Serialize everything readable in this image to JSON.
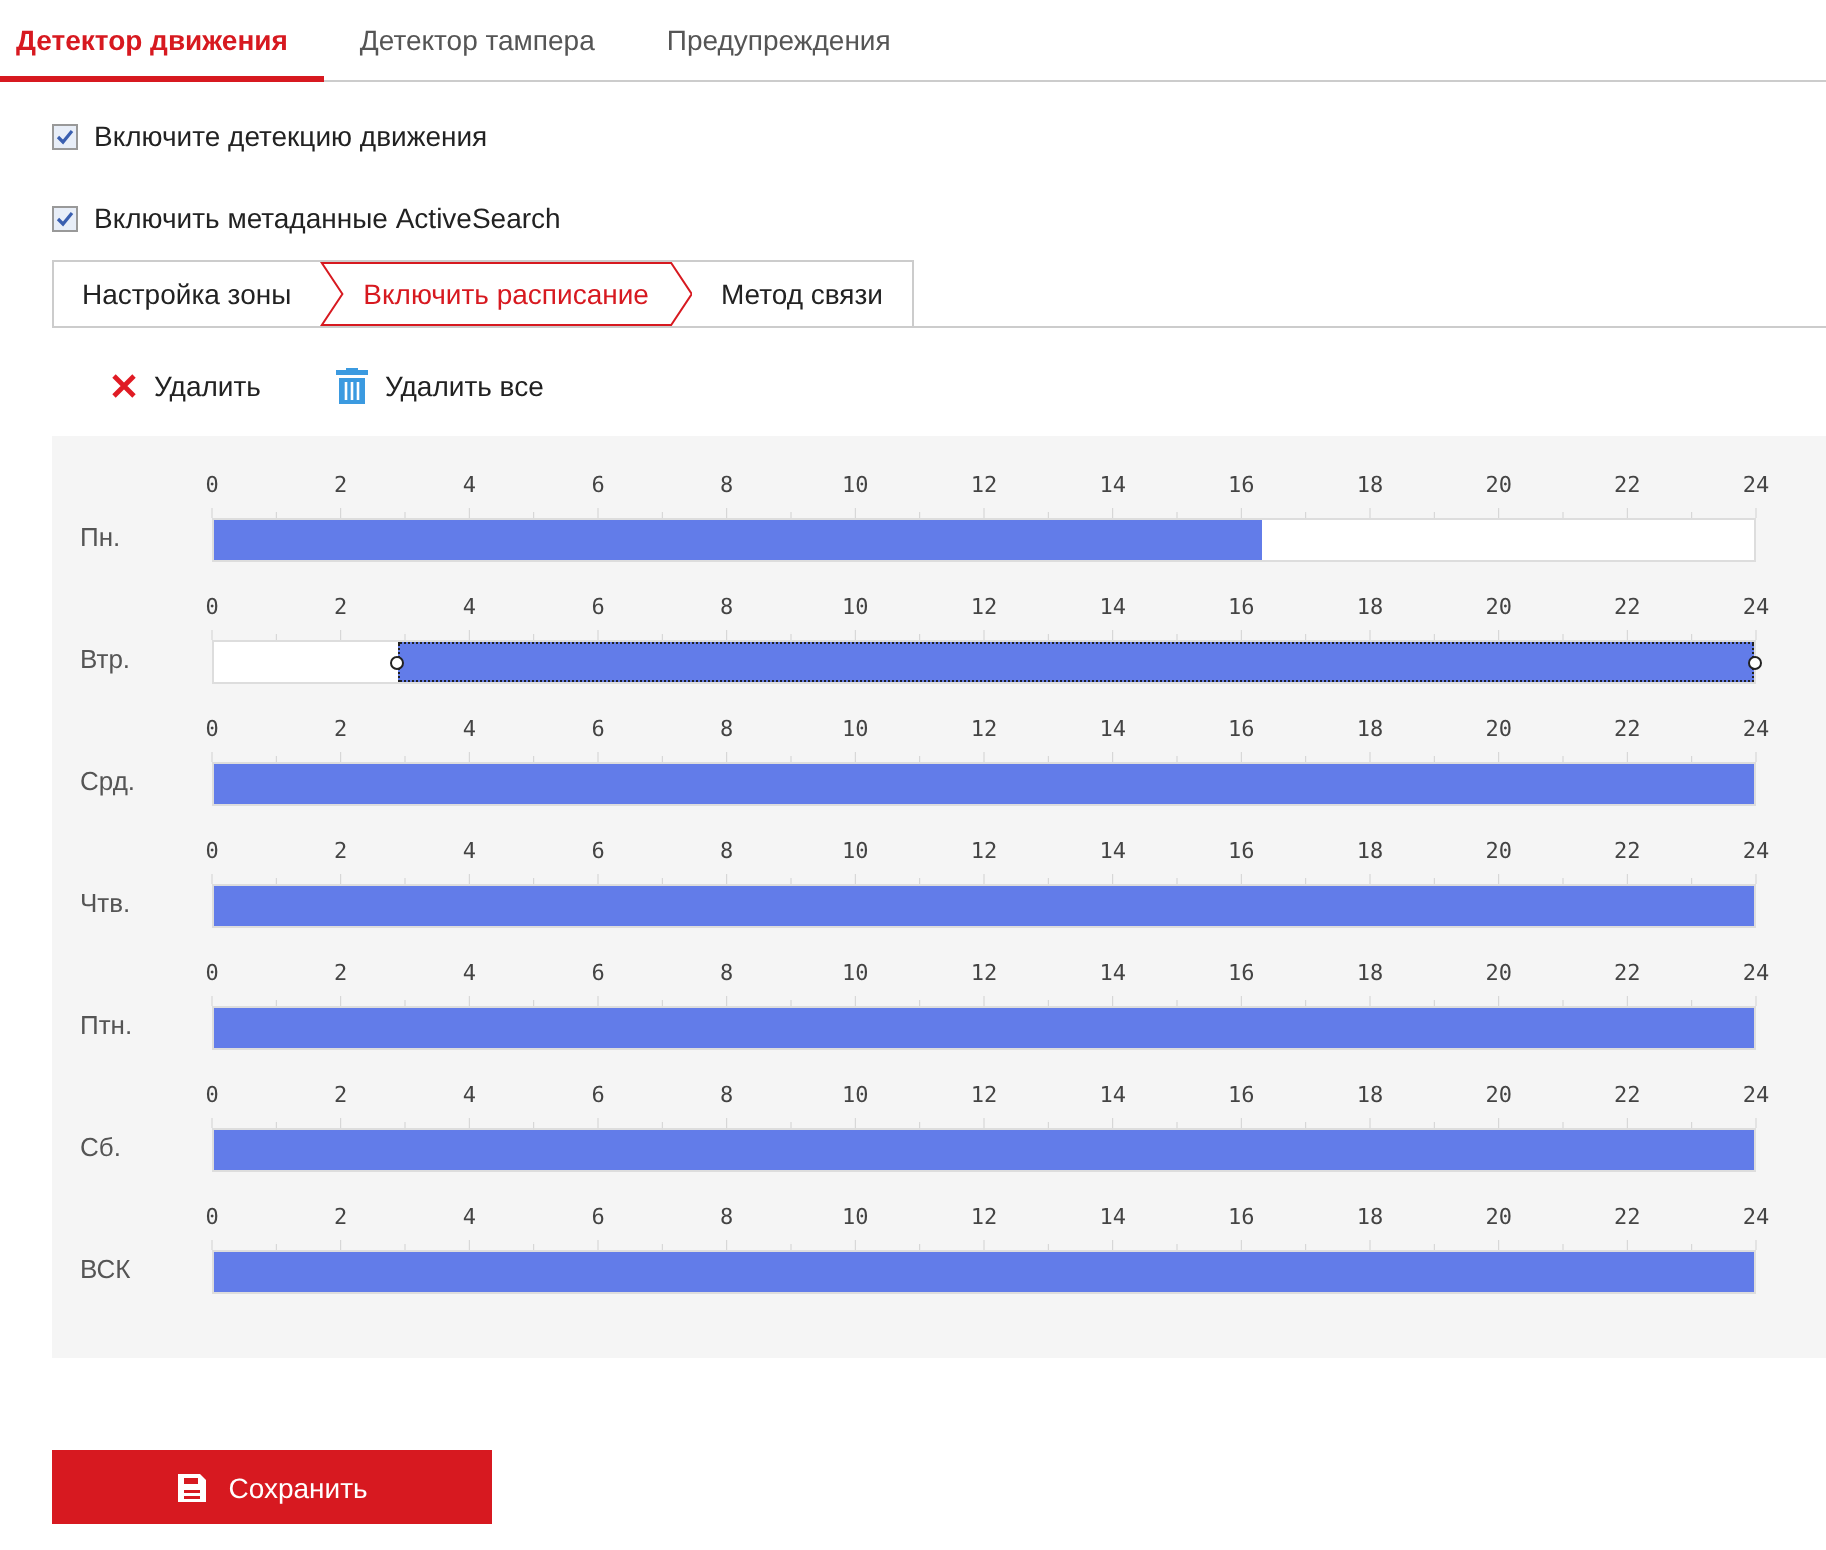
{
  "tabs": [
    {
      "label": "Детектор движения",
      "selected": true
    },
    {
      "label": "Детектор тампера",
      "selected": false
    },
    {
      "label": "Предупреждения",
      "selected": false
    }
  ],
  "options": [
    {
      "label": "Включите детекцию движения",
      "checked": true
    },
    {
      "label": "Включить метаданные ActiveSearch",
      "checked": true
    }
  ],
  "sub_tabs": [
    {
      "label": "Настройка зоны",
      "selected": false
    },
    {
      "label": "Включить расписание",
      "selected": true
    },
    {
      "label": "Метод связи",
      "selected": false
    }
  ],
  "toolbar": [
    {
      "kind": "delete",
      "label": "Удалить"
    },
    {
      "kind": "delete_all",
      "label": "Удалить все"
    }
  ],
  "days": [
    {
      "label": "Пн.",
      "hours": [
        "0",
        "2",
        "4",
        "6",
        "8",
        "10",
        "12",
        "14",
        "16",
        "18",
        "20",
        "22",
        "24"
      ],
      "blocks": [
        {
          "on": true,
          "level": 0.68,
          "selected": false
        }
      ]
    },
    {
      "label": "Втр.",
      "hours": [
        "0",
        "2",
        "4",
        "6",
        "8",
        "10",
        "12",
        "14",
        "16",
        "18",
        "20",
        "22",
        "24"
      ],
      "blocks": [
        {
          "on": false,
          "level": 0.119,
          "selected": false
        },
        {
          "on": true,
          "level": 0.881,
          "selected": true
        }
      ]
    },
    {
      "label": "Срд.",
      "hours": [
        "0",
        "2",
        "4",
        "6",
        "8",
        "10",
        "12",
        "14",
        "16",
        "18",
        "20",
        "22",
        "24"
      ],
      "blocks": [
        {
          "on": true,
          "level": 1,
          "selected": false
        }
      ]
    },
    {
      "label": "Чтв.",
      "hours": [
        "0",
        "2",
        "4",
        "6",
        "8",
        "10",
        "12",
        "14",
        "16",
        "18",
        "20",
        "22",
        "24"
      ],
      "blocks": [
        {
          "on": true,
          "level": 1,
          "selected": false
        }
      ]
    },
    {
      "label": "Птн.",
      "hours": [
        "0",
        "2",
        "4",
        "6",
        "8",
        "10",
        "12",
        "14",
        "16",
        "18",
        "20",
        "22",
        "24"
      ],
      "blocks": [
        {
          "on": true,
          "level": 1,
          "selected": false
        }
      ]
    },
    {
      "label": "Сб.",
      "hours": [
        "0",
        "2",
        "4",
        "6",
        "8",
        "10",
        "12",
        "14",
        "16",
        "18",
        "20",
        "22",
        "24"
      ],
      "blocks": [
        {
          "on": true,
          "level": 1,
          "selected": false
        }
      ]
    },
    {
      "label": "ВСК",
      "hours": [
        "0",
        "2",
        "4",
        "6",
        "8",
        "10",
        "12",
        "14",
        "16",
        "18",
        "20",
        "22",
        "24"
      ],
      "blocks": [
        {
          "on": true,
          "level": 1,
          "selected": false
        }
      ]
    }
  ],
  "save_button": {
    "label": "Сохранить"
  }
}
